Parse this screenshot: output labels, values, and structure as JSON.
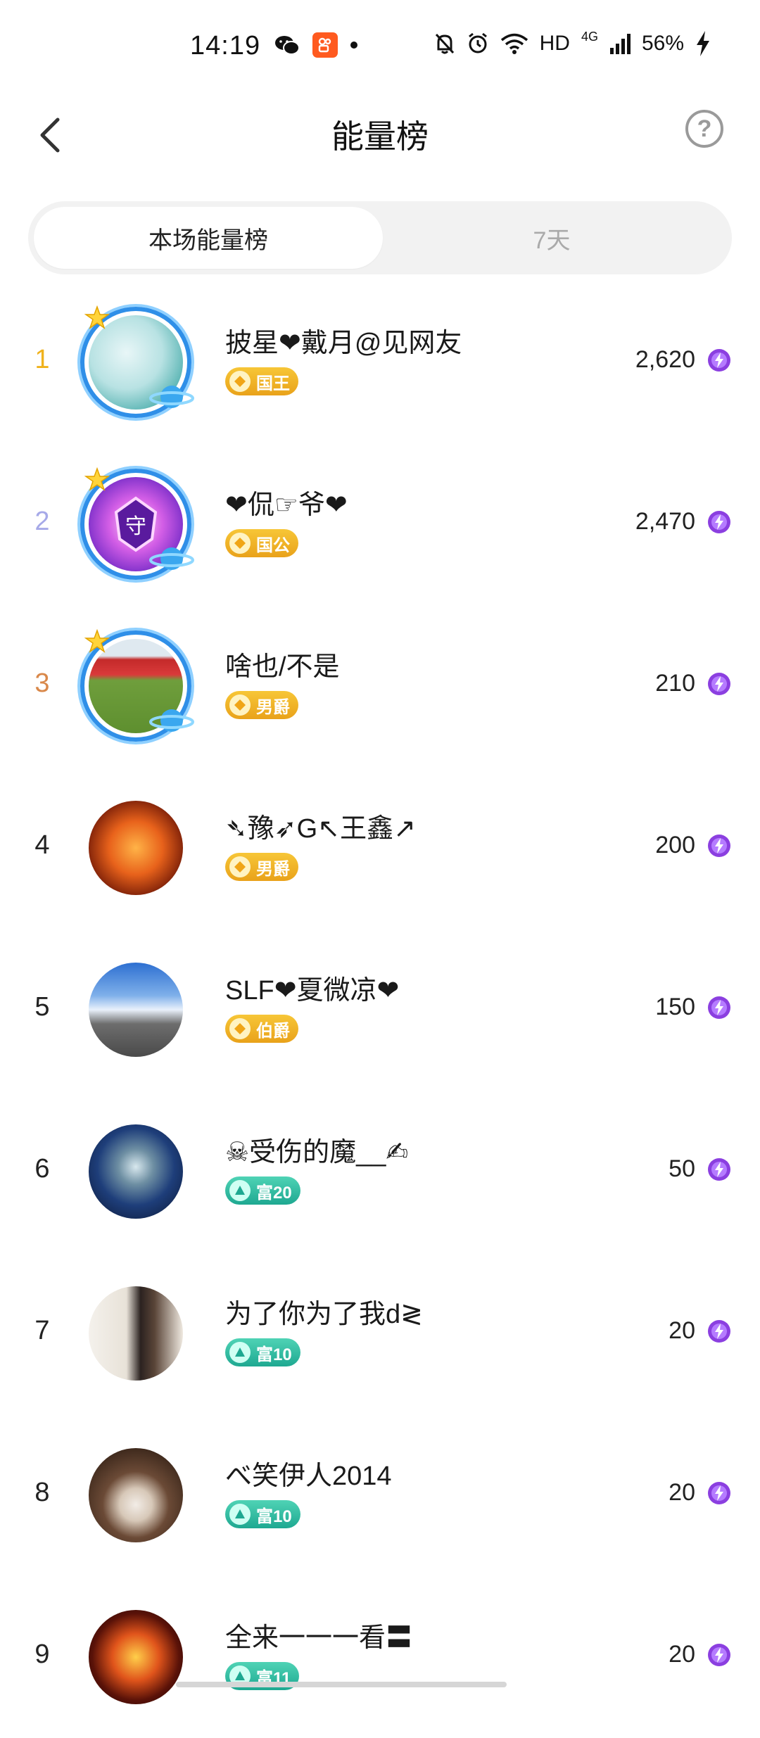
{
  "status_bar": {
    "time": "14:19",
    "hd": "HD",
    "network": "4G",
    "battery": "56%",
    "icons": [
      "wechat-icon",
      "kuaishou-app-icon",
      "notification-dot-icon",
      "mute-bell-icon",
      "alarm-icon",
      "wifi-icon",
      "signal-icon",
      "charging-icon"
    ]
  },
  "header": {
    "title": "能量榜",
    "back_icon": "chevron-left-icon",
    "help_label": "?"
  },
  "tabs": [
    {
      "label": "本场能量榜",
      "active": true
    },
    {
      "label": "7天",
      "active": false
    }
  ],
  "colors": {
    "rank1": "#f0b21c",
    "rank2": "#a6a9e8",
    "rank3": "#d9884a",
    "badge_gold": "#f0b01f",
    "badge_teal": "#27b59a",
    "energy": "#8b3fe0"
  },
  "entries": [
    {
      "rank": "1",
      "name": "披星❤戴月@见网友",
      "badge": "国王",
      "badge_type": "gold",
      "score": "2,620",
      "frame": true
    },
    {
      "rank": "2",
      "name": "❤侃☞爷❤",
      "badge": "国公",
      "badge_type": "gold",
      "score": "2,470",
      "frame": true
    },
    {
      "rank": "3",
      "name": "啥也/不是",
      "badge": "男爵",
      "badge_type": "gold",
      "score": "210",
      "frame": true
    },
    {
      "rank": "4",
      "name": "➴豫➶G↖王鑫↗",
      "badge": "男爵",
      "badge_type": "gold",
      "score": "200",
      "frame": false
    },
    {
      "rank": "5",
      "name": "SLF❤夏微凉❤",
      "badge": "伯爵",
      "badge_type": "gold",
      "score": "150",
      "frame": false
    },
    {
      "rank": "6",
      "name": "☠受伤的魔__✍",
      "badge": "富20",
      "badge_type": "teal",
      "score": "50",
      "frame": false
    },
    {
      "rank": "7",
      "name": "为了你为了我d≷",
      "badge": "富10",
      "badge_type": "teal",
      "score": "20",
      "frame": false
    },
    {
      "rank": "8",
      "name": "べ笑伊人2014",
      "badge": "富10",
      "badge_type": "teal",
      "score": "20",
      "frame": false
    },
    {
      "rank": "9",
      "name": "全来一一一看〓",
      "badge": "富11",
      "badge_type": "teal",
      "score": "20",
      "frame": false
    }
  ]
}
